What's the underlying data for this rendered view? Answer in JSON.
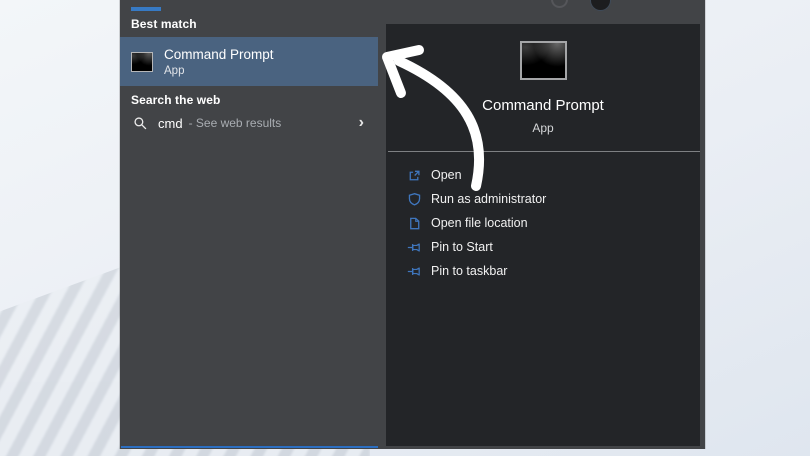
{
  "search_panel": {
    "best_match_header": "Best match",
    "best_match": {
      "title": "Command Prompt",
      "subtitle": "App",
      "icon": "command-prompt-icon"
    },
    "search_web_header": "Search the web",
    "web_result": {
      "query": "cmd",
      "rest": "- See web results",
      "chevron": "›",
      "icon": "magnifier-icon"
    },
    "preview": {
      "title": "Command Prompt",
      "subtitle": "App",
      "icon": "command-prompt-icon",
      "actions": [
        {
          "label": "Open",
          "icon": "open-icon"
        },
        {
          "label": "Run as administrator",
          "icon": "admin-shield-icon"
        },
        {
          "label": "Open file location",
          "icon": "file-location-icon"
        },
        {
          "label": "Pin to Start",
          "icon": "pin-icon"
        },
        {
          "label": "Pin to taskbar",
          "icon": "pin-icon"
        }
      ]
    }
  },
  "annotation": {
    "icon": "hand-drawn-arrow"
  },
  "colors": {
    "accent_blue": "#377ac4",
    "highlight_row": "#4a6380",
    "panel_gray": "#424447",
    "preview_dark": "#232528",
    "action_icon_blue": "#3f76bd",
    "focus_line_blue": "#2c6fc2",
    "arrow_white": "#ffffff"
  }
}
